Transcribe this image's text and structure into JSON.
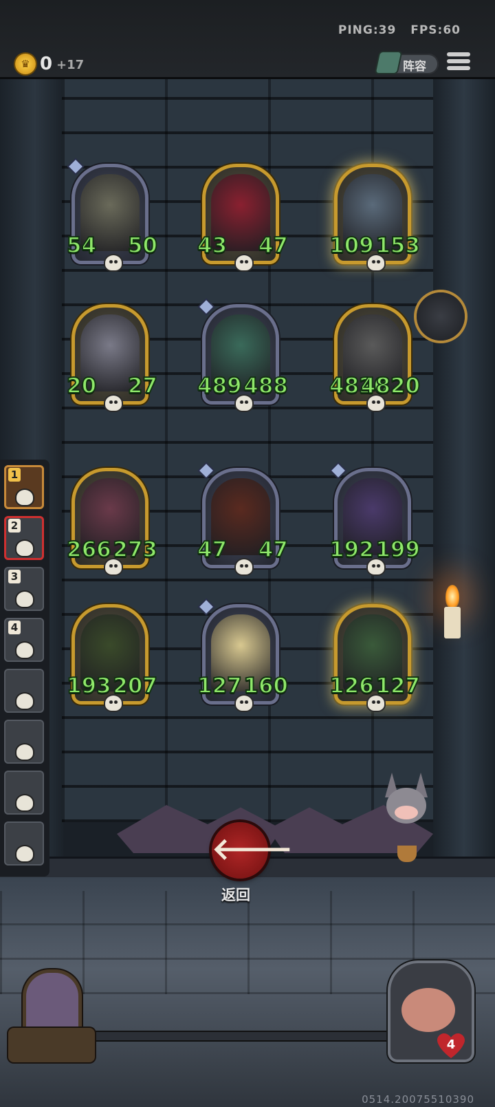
{
  "hud": {
    "ping_label": "PING:39",
    "fps_label": "FPS:60",
    "gold": "0",
    "gold_income": "+17",
    "lineup_label": "阵容"
  },
  "board": {
    "cards": [
      {
        "atk": "54",
        "hp": "50",
        "frame": "purple"
      },
      {
        "atk": "43",
        "hp": "47",
        "frame": "gold"
      },
      {
        "atk": "109",
        "hp": "153",
        "frame": "gold-glow"
      },
      {
        "atk": "20",
        "hp": "27",
        "frame": "gold"
      },
      {
        "atk": "489",
        "hp": "488",
        "frame": "purple"
      },
      {
        "atk": "4820",
        "hp": "4820",
        "frame": "gold"
      },
      {
        "atk": "266",
        "hp": "273",
        "frame": "gold"
      },
      {
        "atk": "47",
        "hp": "47",
        "frame": "purple"
      },
      {
        "atk": "192",
        "hp": "199",
        "frame": "purple"
      },
      {
        "atk": "193",
        "hp": "207",
        "frame": "gold"
      },
      {
        "atk": "127",
        "hp": "160",
        "frame": "purple"
      },
      {
        "atk": "126",
        "hp": "127",
        "frame": "gold-glow"
      }
    ]
  },
  "opponents": [
    {
      "rank": "1"
    },
    {
      "rank": "2"
    },
    {
      "rank": "3"
    },
    {
      "rank": "4"
    },
    {
      "rank": ""
    },
    {
      "rank": ""
    },
    {
      "rank": ""
    },
    {
      "rank": ""
    }
  ],
  "back_label": "返回",
  "back_icon": "arrow-left-icon",
  "shop": {
    "hearts": "4"
  },
  "build_id": "0514.20075510390",
  "colors": {
    "stat_green": "#8fe86a",
    "frame_gold": "#c79a2e",
    "frame_purple": "#6a6f8c",
    "back_red": "#b02626"
  }
}
